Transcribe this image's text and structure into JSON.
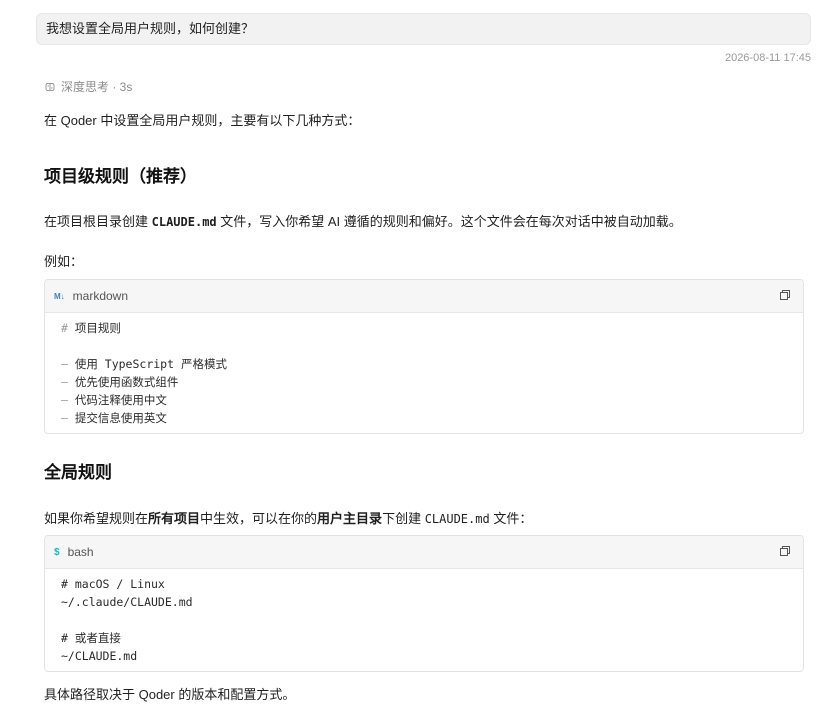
{
  "user_message": "我想设置全局用户规则，如何创建？",
  "timestamp": "2026-08-11 17:45",
  "thinking": {
    "label": "深度思考 · 3s",
    "icon": "brain-icon"
  },
  "intro": "在 Qoder 中设置全局用户规则，主要有以下几种方式：",
  "section1": {
    "heading": "项目级规则（推荐）",
    "para_a": "在项目根目录创建 ",
    "para_code": "CLAUDE.md",
    "para_b": " 文件，写入你希望 AI 遵循的规则和偏好。这个文件会在每次对话中被自动加载。",
    "example_label": "例如："
  },
  "code1": {
    "lang": "markdown",
    "lang_icon_text": "M↓",
    "lines": [
      {
        "mark": "#",
        "text": " 项目规则"
      },
      {
        "mark": "",
        "text": ""
      },
      {
        "mark": "–",
        "text": " 使用 TypeScript 严格模式"
      },
      {
        "mark": "–",
        "text": " 优先使用函数式组件"
      },
      {
        "mark": "–",
        "text": " 代码注释使用中文"
      },
      {
        "mark": "–",
        "text": " 提交信息使用英文"
      }
    ]
  },
  "section2": {
    "heading": "全局规则",
    "para_a": "如果你希望规则在",
    "para_bold1": "所有项目",
    "para_b": "中生效，可以在你的",
    "para_bold2": "用户主目录",
    "para_c": "下创建 ",
    "para_code": "CLAUDE.md",
    "para_d": " 文件："
  },
  "code2": {
    "lang": "bash",
    "lang_icon_text": "$",
    "lines": [
      "# macOS / Linux",
      "~/.claude/CLAUDE.md",
      "",
      "# 或者直接",
      "~/CLAUDE.md"
    ]
  },
  "closing": "具体路径取决于 Qoder 的版本和配置方式。"
}
